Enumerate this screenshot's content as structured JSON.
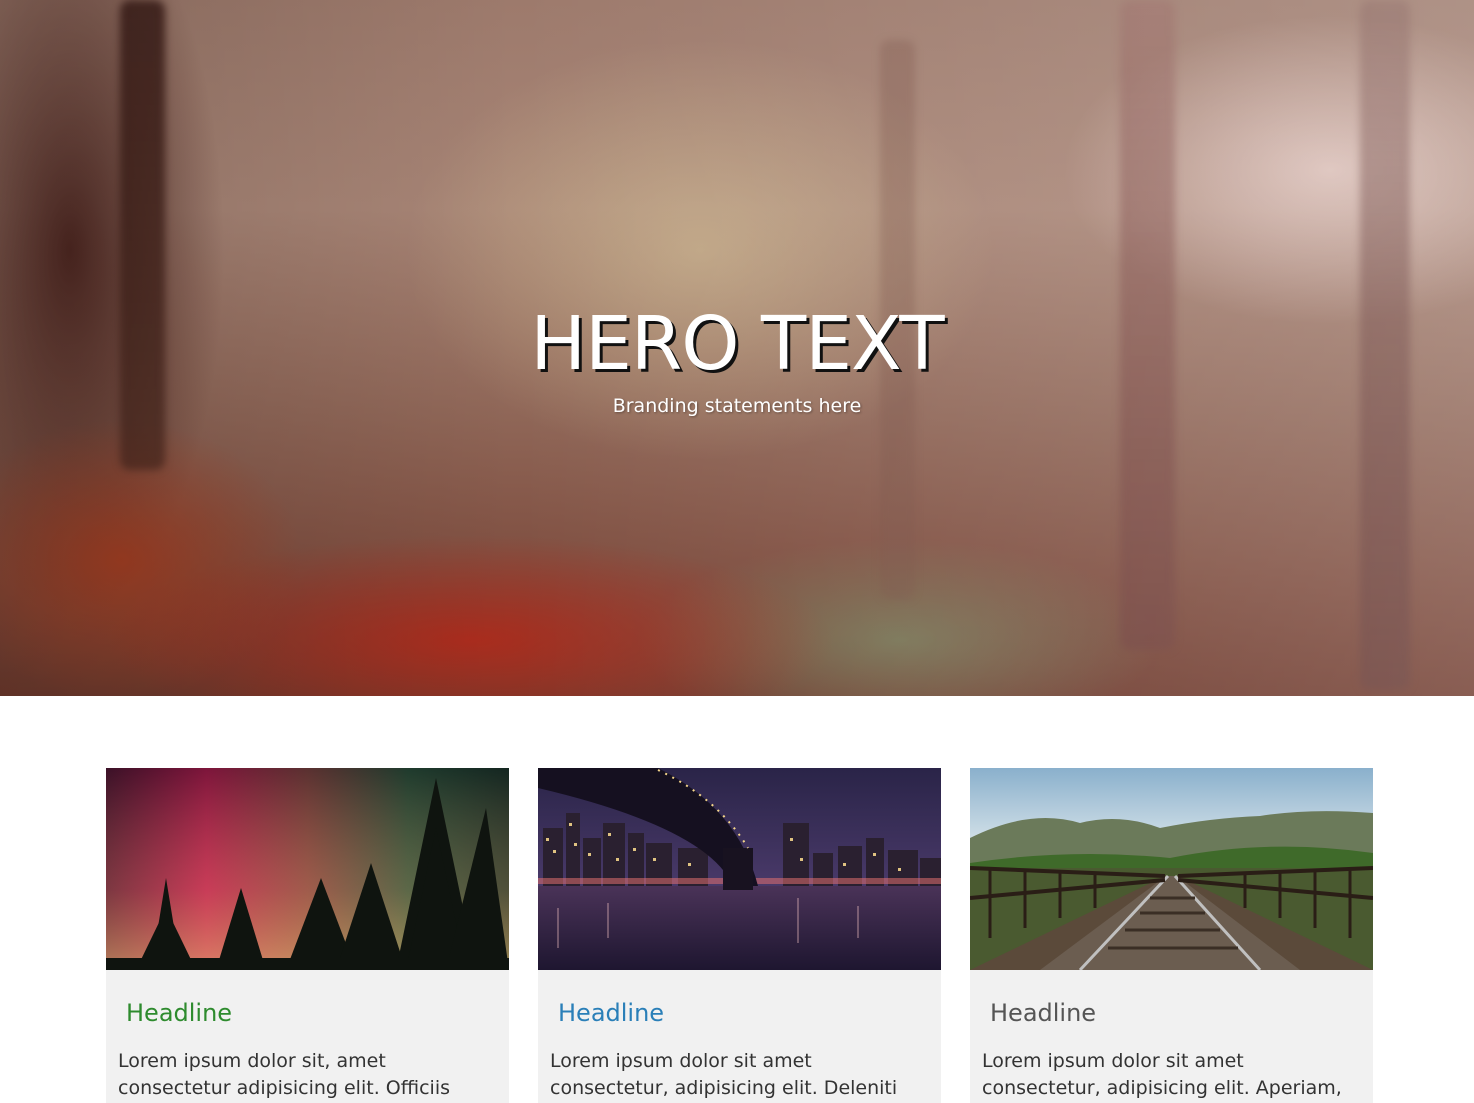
{
  "hero": {
    "title": "HERO TEXT",
    "subtitle": "Branding statements here"
  },
  "cards": [
    {
      "image": "aurora-pine-trees",
      "headline": "Headline",
      "headline_color": "#2e8b2e",
      "text": "Lorem ipsum dolor sit, amet consectetur adipisicing elit. Officiis praesentium et"
    },
    {
      "image": "city-bridge-night",
      "headline": "Headline",
      "headline_color": "#2a7fb8",
      "text": "Lorem ipsum dolor sit amet consectetur, adipisicing elit. Deleniti ullam voluptate"
    },
    {
      "image": "railway-bridge-mountains",
      "headline": "Headline",
      "headline_color": "#555555",
      "text": "Lorem ipsum dolor sit amet consectetur, adipisicing elit. Aperiam, reprehenderit"
    }
  ]
}
